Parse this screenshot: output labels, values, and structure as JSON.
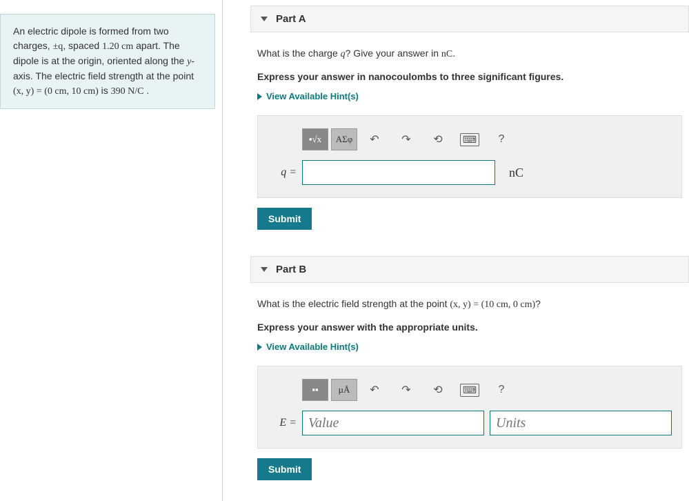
{
  "problem": {
    "textPrefix": "An electric dipole is formed from two charges, ",
    "chargeSymbol": "±q",
    "text2": ", spaced ",
    "spacing": "1.20 cm",
    "text3": " apart. The dipole is at the origin, oriented along the ",
    "axis": "y",
    "text4": "-axis. The electric field strength at the point ",
    "pointExpr": "(x, y) = (0 cm, 10 cm)",
    "text5": " is ",
    "fieldValue": "390 N/C",
    "text6": " ."
  },
  "partA": {
    "title": "Part A",
    "questionPrefix": "What is the charge ",
    "questionVar": "q",
    "questionMid": "? Give your answer in ",
    "questionUnit": "nC",
    "questionEnd": ".",
    "instruction": "Express your answer in nanocoulombs to three significant figures.",
    "hintsLabel": "View Available Hint(s)",
    "varLabel": "q",
    "unitLabel": "nC",
    "submit": "Submit",
    "toolMath": "√x",
    "toolGreek": "ΑΣφ"
  },
  "partB": {
    "title": "Part B",
    "questionPrefix": "What is the electric field strength at the point ",
    "questionExpr": "(x, y) = (10 cm, 0 cm)",
    "questionEnd": "?",
    "instruction": "Express your answer with the appropriate units.",
    "hintsLabel": "View Available Hint(s)",
    "varLabel": "E",
    "valuePlaceholder": "Value",
    "unitsPlaceholder": "Units",
    "submit": "Submit",
    "toolUnits": "µÅ"
  }
}
